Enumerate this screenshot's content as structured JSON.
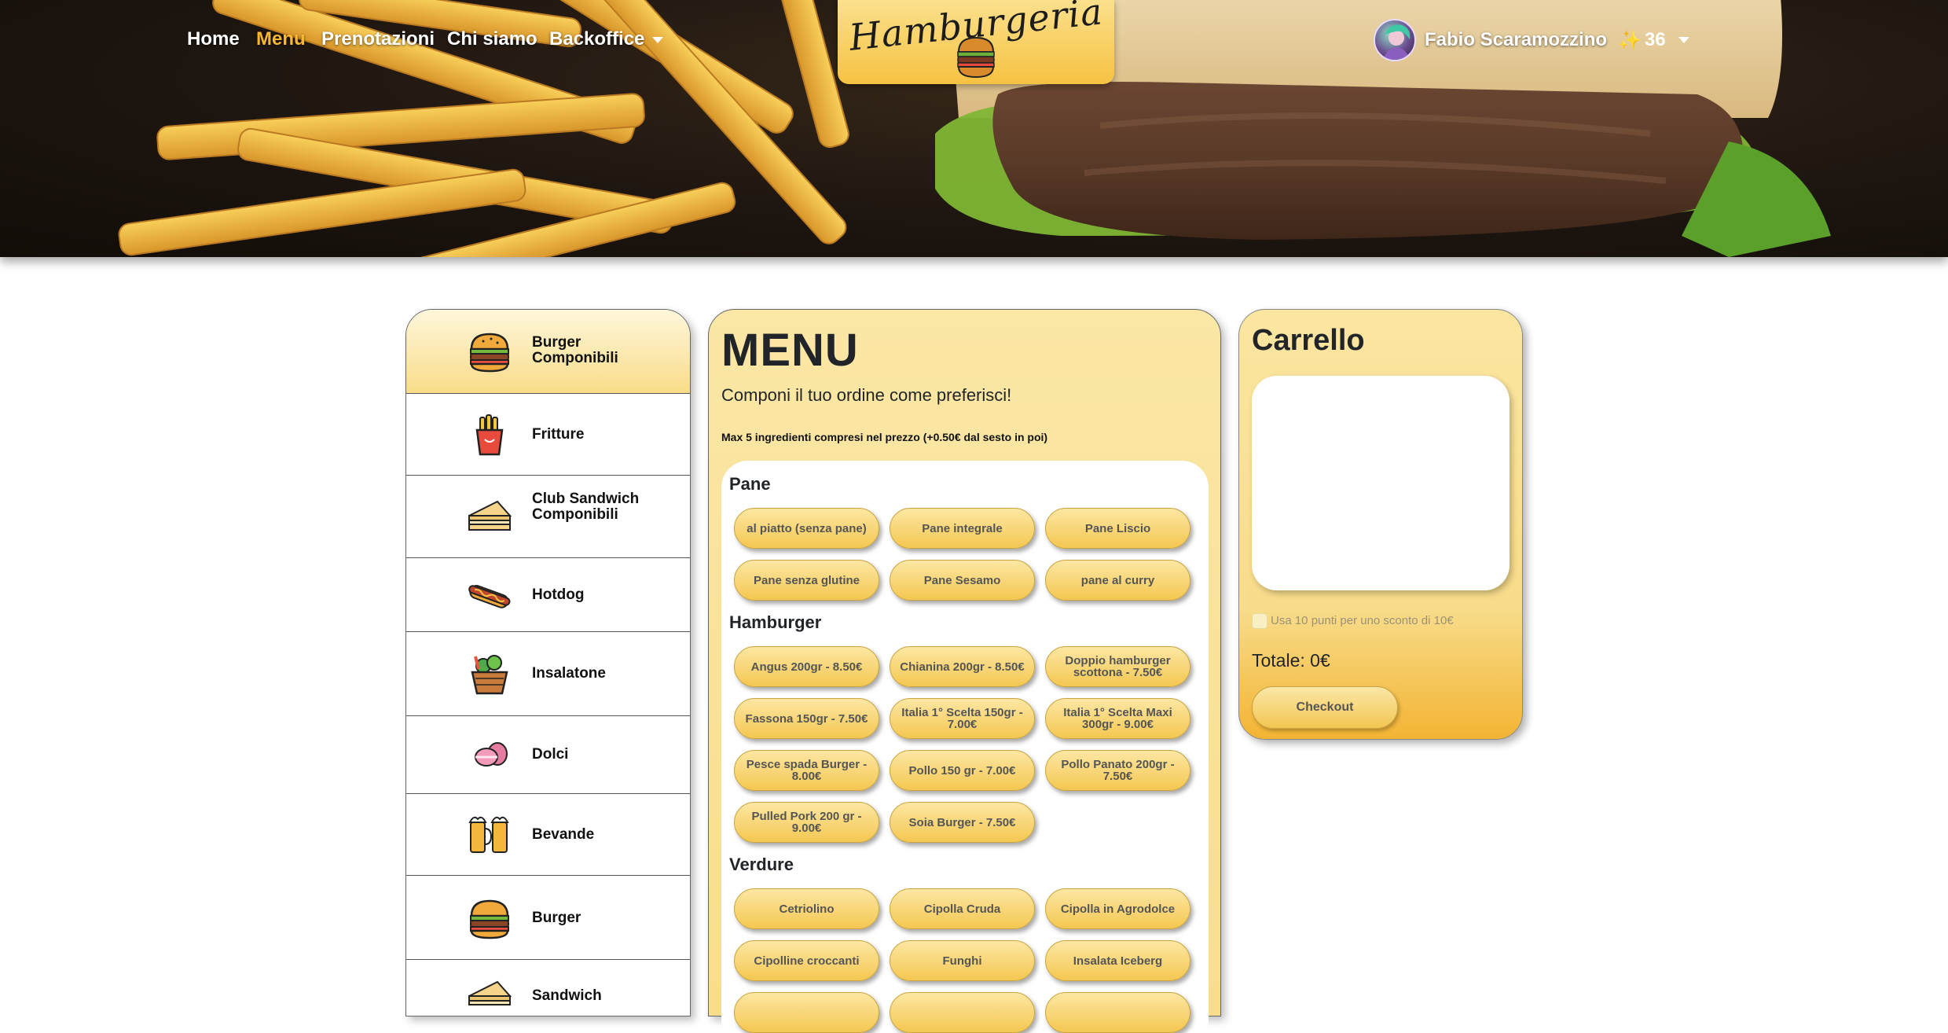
{
  "nav": {
    "links": [
      "Home",
      "Menu",
      "Prenotazioni",
      "Chi siamo",
      "Backoffice"
    ],
    "active": "Menu"
  },
  "logo": {
    "text": "Hamburgeria"
  },
  "user": {
    "name": "Fabio Scaramozzino",
    "sparkle": "✨",
    "points": "36"
  },
  "sidebar": {
    "items": [
      {
        "label": "Burger Componibili",
        "icon": "burger-icon"
      },
      {
        "label": "Fritture",
        "icon": "fries-icon"
      },
      {
        "label": "Club Sandwich Componibili",
        "icon": "sandwich-icon"
      },
      {
        "label": "Hotdog",
        "icon": "hotdog-icon"
      },
      {
        "label": "Insalatone",
        "icon": "salad-basket-icon"
      },
      {
        "label": "Dolci",
        "icon": "macaron-icon"
      },
      {
        "label": "Bevande",
        "icon": "beer-mugs-icon"
      },
      {
        "label": "Burger",
        "icon": "burger-icon"
      },
      {
        "label": "Sandwich",
        "icon": "sandwich-icon"
      }
    ]
  },
  "menu": {
    "title": "MENU",
    "subtitle": "Componi il tuo ordine come preferisci!",
    "note": "Max 5 ingredienti compresi nel prezzo (+0.50€ dal sesto in poi)",
    "sections": [
      {
        "name": "Pane",
        "items": [
          "al piatto (senza pane)",
          "Pane integrale",
          "Pane Liscio",
          "Pane senza glutine",
          "Pane Sesamo",
          "pane al curry"
        ]
      },
      {
        "name": "Hamburger",
        "items": [
          "Angus 200gr - 8.50€",
          "Chianina 200gr - 8.50€",
          "Doppio hamburger scottona - 7.50€",
          "Fassona 150gr - 7.50€",
          "Italia 1° Scelta 150gr - 7.00€",
          "Italia 1° Scelta Maxi 300gr - 9.00€",
          "Pesce spada Burger - 8.00€",
          "Pollo 150 gr - 7.00€",
          "Pollo Panato 200gr - 7.50€",
          "Pulled Pork 200 gr - 9.00€",
          "Soia Burger - 7.50€"
        ]
      },
      {
        "name": "Verdure",
        "items": [
          "Cetriolino",
          "Cipolla Cruda",
          "Cipolla in Agrodolce",
          "Cipolline croccanti",
          "Funghi",
          "Insalata Iceberg",
          "",
          "",
          ""
        ]
      }
    ]
  },
  "cart": {
    "title": "Carrello",
    "discount_label": "Usa 10 punti per uno sconto di 10€",
    "total": "Totale: 0€",
    "checkout_label": "Checkout"
  },
  "colors": {
    "accent": "#f7b733",
    "panel": "#f8dd8c",
    "pill": "#f4c751"
  }
}
